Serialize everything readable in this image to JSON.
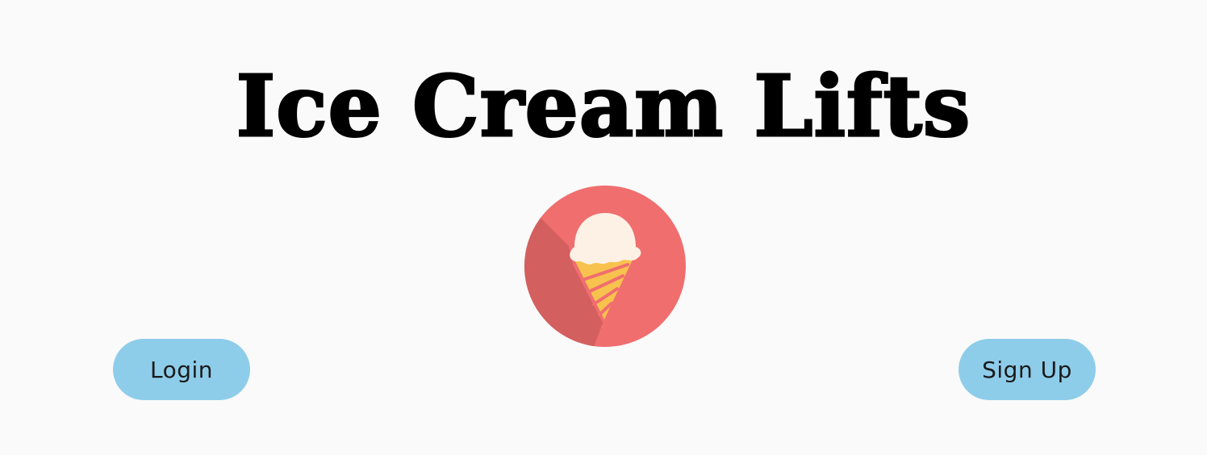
{
  "header": {
    "title": "Ice Cream Lifts"
  },
  "logo": {
    "icon": "ice-cream-cone-icon",
    "colors": {
      "circle": "#f06e6e",
      "shadow": "#d35f5f",
      "scoop": "#fdf1e6",
      "cone": "#f8c24e",
      "stripe": "#f06e6e"
    }
  },
  "actions": {
    "login_label": "Login",
    "signup_label": "Sign Up",
    "button_color": "#8ecdea"
  }
}
